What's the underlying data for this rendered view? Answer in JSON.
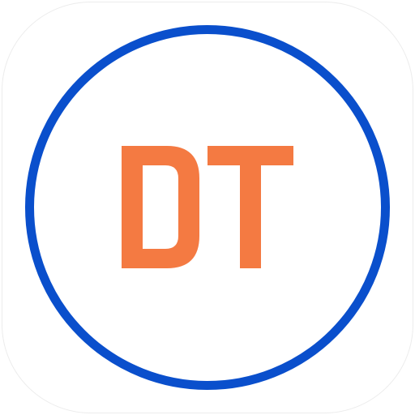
{
  "app_icon": {
    "monogram": "DT",
    "colors": {
      "ring": "#0a4fcc",
      "monogram": "#f47a42",
      "background": "#ffffff",
      "icon_border": "#ececec"
    }
  }
}
